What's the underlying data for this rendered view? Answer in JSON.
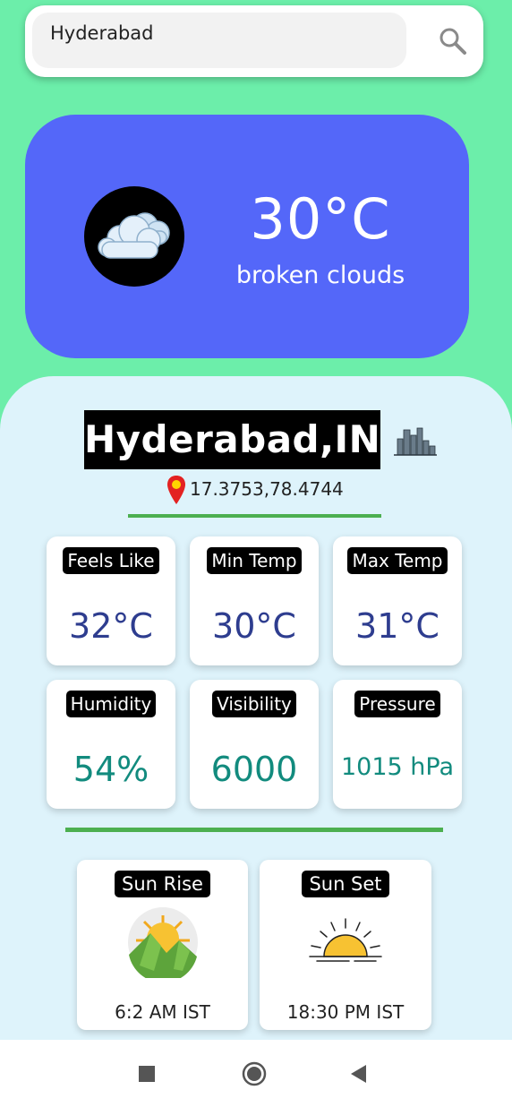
{
  "search": {
    "value": "Hyderabad",
    "icon": "search-icon"
  },
  "current": {
    "temperature": "30°C",
    "description": "broken clouds",
    "icon": "cloud-icon"
  },
  "location": {
    "city": "Hyderabad,IN",
    "coordinates": "17.3753,78.4744",
    "city_icon": "city-skyline-icon",
    "pin_icon": "location-pin-icon"
  },
  "stats": [
    {
      "label": "Feels Like",
      "value": "32°C"
    },
    {
      "label": "Min Temp",
      "value": "30°C"
    },
    {
      "label": "Max Temp",
      "value": "31°C"
    },
    {
      "label": "Humidity",
      "value": "54%"
    },
    {
      "label": "Visibility",
      "value": "6000"
    },
    {
      "label": "Pressure",
      "value": "1015 hPa"
    }
  ],
  "sun": {
    "rise": {
      "label": "Sun Rise",
      "time": "6:2 AM IST",
      "icon": "sunrise-icon"
    },
    "set": {
      "label": "Sun Set",
      "time": "18:30 PM IST",
      "icon": "sunset-icon"
    }
  },
  "nav": {
    "recents": "square-icon",
    "home": "circle-icon",
    "back": "triangle-back-icon"
  },
  "colors": {
    "background": "#6ceeaa",
    "weather_card": "#5467f9",
    "panel": "#def3fb",
    "divider": "#4caf50",
    "value_blue": "#2e3d8f",
    "value_teal": "#128b7e"
  }
}
